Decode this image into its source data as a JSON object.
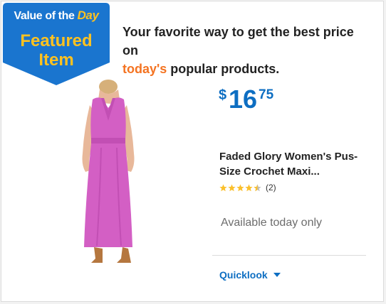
{
  "badge": {
    "top_text": "Value of the",
    "top_accent": "Day",
    "main_line1": "Featured",
    "main_line2": "Item"
  },
  "headline": {
    "line1": "Your favorite way to get the best price on",
    "accent": "today's",
    "line2_rest": " popular products."
  },
  "product": {
    "price_symbol": "$",
    "price_whole": "16",
    "price_cents": "75",
    "title": "Faded Glory Women's Pus-Size Crochet Maxi...",
    "rating": 4.5,
    "review_count": "(2)",
    "availability": "Available today only",
    "quicklook_label": "Quicklook"
  },
  "colors": {
    "badge_blue": "#1a75cf",
    "badge_yellow": "#ffc220",
    "accent_orange": "#f47321",
    "price_blue": "#0d6ec2",
    "star_yellow": "#fbc02d",
    "dress_pink": "#d35fc4"
  },
  "icons": {
    "star": "star-icon",
    "caret": "chevron-down-icon"
  }
}
